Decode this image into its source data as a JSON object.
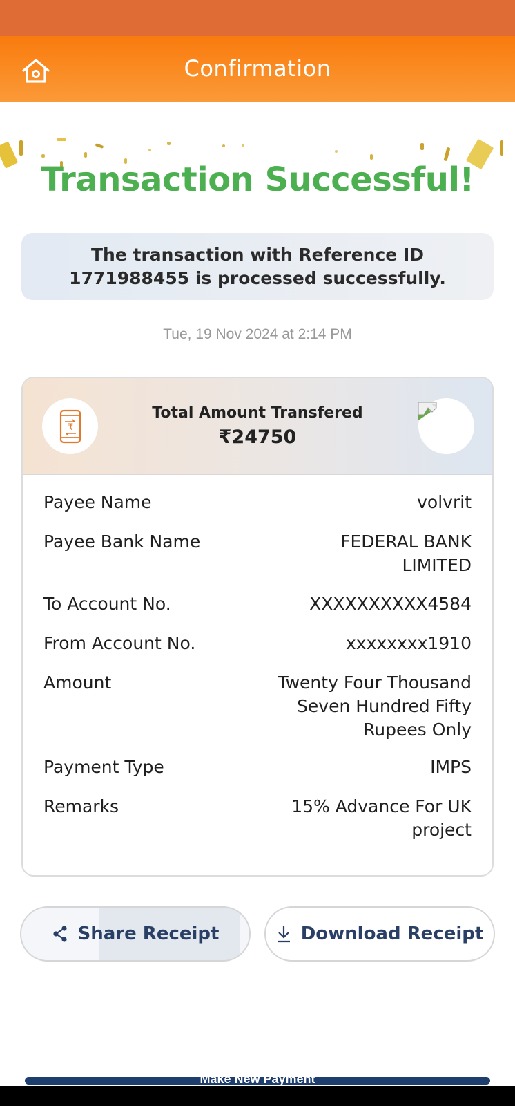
{
  "header": {
    "title": "Confirmation",
    "home_icon": "home-icon"
  },
  "status": {
    "title": "Transaction Successful!",
    "message": "The transaction with Reference ID 1771988455 is processed successfully.",
    "timestamp": "Tue, 19 Nov 2024 at 2:14 PM"
  },
  "summary": {
    "total_label": "Total Amount Transfered",
    "total_value": "₹24750",
    "left_icon": "mobile-rupee-transfer-icon",
    "right_icon": "broken-image-icon"
  },
  "details": [
    {
      "label": "Payee Name",
      "value": "volvrit"
    },
    {
      "label": "Payee Bank Name",
      "value": "FEDERAL BANK LIMITED"
    },
    {
      "label": "To Account No.",
      "value": "XXXXXXXXXX4584"
    },
    {
      "label": "From Account No.",
      "value": "xxxxxxxx1910"
    },
    {
      "label": "Amount",
      "value": "Twenty Four Thousand Seven Hundred Fifty Rupees Only"
    },
    {
      "label": "Payment Type",
      "value": "IMPS"
    },
    {
      "label": "Remarks",
      "value": "15% Advance For UK project"
    }
  ],
  "actions": {
    "share_label": "Share Receipt",
    "download_label": "Download Receipt",
    "make_new_label": "Make New Payment"
  },
  "colors": {
    "header_orange": "#f97b0d",
    "success_green": "#4caf50",
    "button_text": "#2a3f66",
    "bottom_button": "#1e3f6e"
  }
}
